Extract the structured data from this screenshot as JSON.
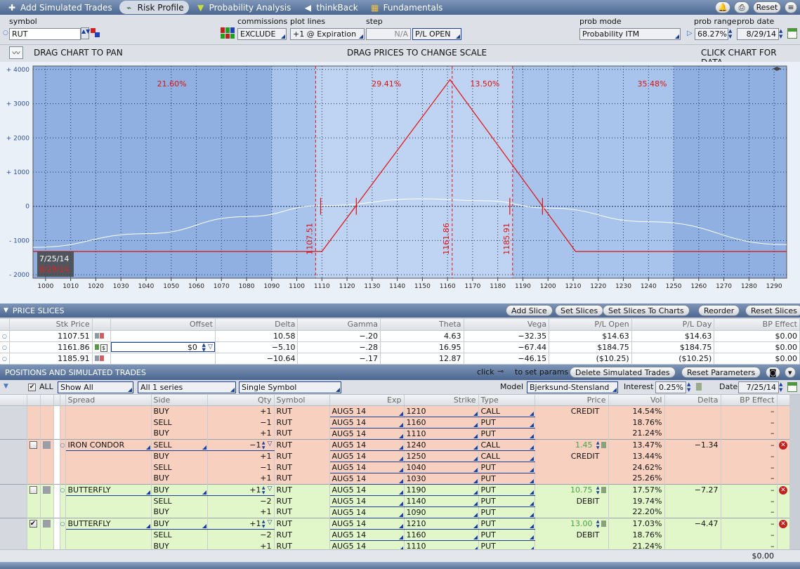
{
  "toolbar": {
    "tabs": [
      {
        "label": "Add Simulated Trades",
        "icon": "plus-icon"
      },
      {
        "label": "Risk Profile",
        "icon": "chart-icon"
      },
      {
        "label": "Probability Analysis",
        "icon": "probability-icon"
      },
      {
        "label": "thinkBack",
        "icon": "thinkback-icon"
      },
      {
        "label": "Fundamentals",
        "icon": "fundamentals-icon"
      }
    ],
    "active_tab": "Risk Profile",
    "reset_label": "Reset"
  },
  "controls": {
    "symbol_label": "symbol",
    "symbol_value": "RUT",
    "commissions_label": "commissions",
    "commissions_value": "EXCLUDE",
    "plot_lines_label": "plot lines",
    "plot_lines_value": "+1 @ Expiration",
    "step_label": "step",
    "step_value": "N/A",
    "pl_open_value": "P/L OPEN",
    "prob_mode_label": "prob mode",
    "prob_mode_value": "Probability ITM",
    "prob_range_label": "prob range",
    "prob_range_value": "68.27%",
    "prob_date_label": "prob date",
    "prob_date_value": "8/29/14"
  },
  "chart_info": {
    "left": "DRAG CHART TO PAN",
    "center": "DRAG PRICES TO CHANGE SCALE",
    "right": "CLICK CHART FOR DATA"
  },
  "chart_data": {
    "type": "line",
    "xlim": [
      995,
      1295
    ],
    "ylim": [
      -2100,
      4100
    ],
    "x_ticks": [
      1000,
      1010,
      1020,
      1030,
      1040,
      1050,
      1060,
      1070,
      1080,
      1090,
      1100,
      1110,
      1120,
      1130,
      1140,
      1150,
      1160,
      1170,
      1180,
      1190,
      1200,
      1210,
      1220,
      1230,
      1240,
      1250,
      1260,
      1270,
      1280,
      1290
    ],
    "y_ticks": [
      {
        "v": 4000,
        "label": "+ 4000"
      },
      {
        "v": 3000,
        "label": "+ 3000"
      },
      {
        "v": 2000,
        "label": "+ 2000"
      },
      {
        "v": 1000,
        "label": "+ 1000"
      },
      {
        "v": 0,
        "label": "0"
      },
      {
        "v": -1000,
        "label": "- 1000"
      },
      {
        "v": -2000,
        "label": "- 2000"
      }
    ],
    "series": [
      {
        "color": "#e01010",
        "points": [
          [
            995,
            -1320
          ],
          [
            1100,
            -1320
          ],
          [
            1110,
            -1320
          ],
          [
            1161,
            3700
          ],
          [
            1211,
            -1320
          ],
          [
            1295,
            -1320
          ]
        ]
      },
      {
        "color": "#ffffff",
        "points": [
          [
            995,
            -1200
          ],
          [
            1040,
            -800
          ],
          [
            1080,
            -300
          ],
          [
            1110,
            20
          ],
          [
            1150,
            220
          ],
          [
            1175,
            160
          ],
          [
            1200,
            -50
          ],
          [
            1240,
            -450
          ],
          [
            1295,
            -1120
          ]
        ]
      }
    ],
    "prob_lines": [
      1107.51,
      1185.91
    ],
    "center_line": 1161.86,
    "vertical_labels": [
      "1107.51",
      "1161.86",
      "1185.91"
    ],
    "zone_labels": [
      "21.60%",
      "29.41%",
      "13.50%",
      "35.48%"
    ],
    "date_labels": [
      "7/25/14",
      "8/29/14"
    ],
    "grid": true
  },
  "price_slices": {
    "title": "PRICE SLICES",
    "buttons": [
      "Add Slice",
      "Set Slices",
      "Set Slices To Charts",
      "Reorder",
      "Reset Slices"
    ],
    "headers": [
      "Stk Price",
      "Offset",
      "Delta",
      "Gamma",
      "Theta",
      "Vega",
      "P/L Open",
      "P/L Day",
      "BP Effect"
    ],
    "rows": [
      [
        "1107.51",
        "",
        "10.58",
        "−.20",
        "4.63",
        "−32.35",
        "$14.63",
        "$14.63",
        "$0.00"
      ],
      [
        "1161.86",
        "$0",
        "−5.10",
        "−.28",
        "16.95",
        "−67.44",
        "$184.75",
        "$184.75",
        "$0.00"
      ],
      [
        "1185.91",
        "",
        "−10.64",
        "−.17",
        "12.87",
        "−46.15",
        "($10.25)",
        "($10.25)",
        "$0.00"
      ]
    ]
  },
  "positions": {
    "title": "POSITIONS AND SIMULATED TRADES",
    "click_hint": "click",
    "click_hint2": "to set params",
    "delete_btn": "Delete Simulated Trades",
    "reset_params_btn": "Reset Parameters",
    "all_label": "ALL",
    "show_all": "Show All",
    "series": "All 1 series",
    "single_symbol": "Single Symbol",
    "model_label": "Model",
    "model_value": "Bjerksund-Stensland",
    "interest_label": "Interest",
    "interest_value": "0.25%",
    "date_label": "Date",
    "date_value": "7/25/14",
    "headers": [
      "Spread",
      "Side",
      "Qty",
      "Symbol",
      "Exp",
      "Strike",
      "Type",
      "Price",
      "Vol",
      "Delta",
      "BP Effect"
    ],
    "total": "$0.00",
    "groups": [
      {
        "color": "pink",
        "spread": "",
        "price": "",
        "price_type": "CREDIT",
        "delta": "",
        "checked": false,
        "legs": [
          {
            "side": "BUY",
            "qty": "+1",
            "symbol": "RUT",
            "exp": "AUG5 14",
            "strike": "1210",
            "type": "CALL",
            "vol": "14.54%",
            "bp": "–"
          },
          {
            "side": "SELL",
            "qty": "−1",
            "symbol": "RUT",
            "exp": "AUG5 14",
            "strike": "1160",
            "type": "PUT",
            "vol": "18.76%",
            "bp": "–"
          },
          {
            "side": "BUY",
            "qty": "+1",
            "symbol": "RUT",
            "exp": "AUG5 14",
            "strike": "1110",
            "type": "PUT",
            "vol": "21.24%",
            "bp": "–"
          }
        ]
      },
      {
        "color": "pink",
        "spread": "IRON CONDOR",
        "price": "1.45",
        "price_type": "CREDIT",
        "delta": "−1.34",
        "checked": false,
        "legs": [
          {
            "side": "SELL",
            "qty": "−1",
            "symbol": "RUT",
            "exp": "AUG5 14",
            "strike": "1240",
            "type": "CALL",
            "vol": "13.47%",
            "bp": "–"
          },
          {
            "side": "BUY",
            "qty": "+1",
            "symbol": "RUT",
            "exp": "AUG5 14",
            "strike": "1250",
            "type": "CALL",
            "vol": "13.44%",
            "bp": "–"
          },
          {
            "side": "SELL",
            "qty": "−1",
            "symbol": "RUT",
            "exp": "AUG5 14",
            "strike": "1040",
            "type": "PUT",
            "vol": "24.62%",
            "bp": "–"
          },
          {
            "side": "BUY",
            "qty": "+1",
            "symbol": "RUT",
            "exp": "AUG5 14",
            "strike": "1030",
            "type": "PUT",
            "vol": "25.26%",
            "bp": "–"
          }
        ]
      },
      {
        "color": "green",
        "spread": "BUTTERFLY",
        "price": "10.75",
        "price_type": "DEBIT",
        "delta": "−7.27",
        "checked": false,
        "legs": [
          {
            "side": "BUY",
            "qty": "+1",
            "symbol": "RUT",
            "exp": "AUG5 14",
            "strike": "1190",
            "type": "PUT",
            "vol": "17.57%",
            "bp": "–"
          },
          {
            "side": "SELL",
            "qty": "−2",
            "symbol": "RUT",
            "exp": "AUG5 14",
            "strike": "1140",
            "type": "PUT",
            "vol": "19.74%",
            "bp": "–"
          },
          {
            "side": "BUY",
            "qty": "+1",
            "symbol": "RUT",
            "exp": "AUG5 14",
            "strike": "1090",
            "type": "PUT",
            "vol": "22.20%",
            "bp": "–"
          }
        ]
      },
      {
        "color": "green",
        "spread": "BUTTERFLY",
        "price": "13.00",
        "price_type": "DEBIT",
        "delta": "−4.47",
        "checked": true,
        "legs": [
          {
            "side": "BUY",
            "qty": "+1",
            "symbol": "RUT",
            "exp": "AUG5 14",
            "strike": "1210",
            "type": "PUT",
            "vol": "17.03%",
            "bp": "–"
          },
          {
            "side": "SELL",
            "qty": "−2",
            "symbol": "RUT",
            "exp": "AUG5 14",
            "strike": "1160",
            "type": "PUT",
            "vol": "18.76%",
            "bp": "–"
          },
          {
            "side": "BUY",
            "qty": "+1",
            "symbol": "RUT",
            "exp": "AUG5 14",
            "strike": "1110",
            "type": "PUT",
            "vol": "21.24%",
            "bp": "–"
          }
        ]
      }
    ]
  }
}
